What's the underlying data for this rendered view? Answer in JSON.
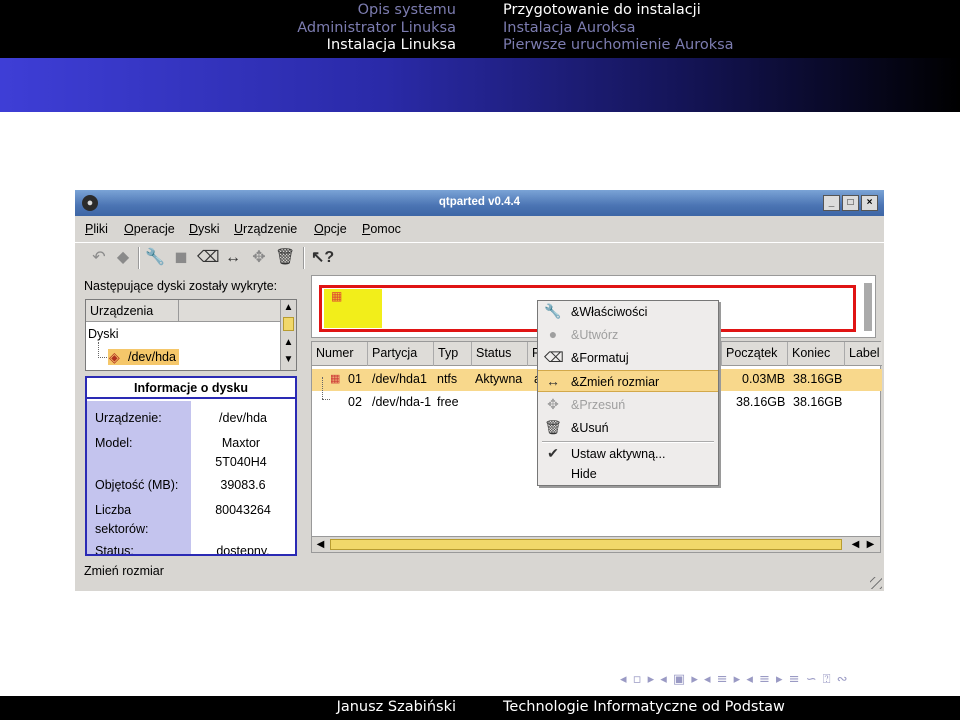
{
  "header": {
    "left_sections": [
      "Opis systemu",
      "Administrator Linuksa",
      "Instalacja Linuksa"
    ],
    "left_current_index": 2,
    "right_subsections": [
      "Przygotowanie do instalacji",
      "Instalacja Auroksa",
      "Pierwsze uruchomienie Auroksa"
    ],
    "right_current_index": 0
  },
  "footer": {
    "author": "Janusz Szabiński",
    "course": "Technologie Informatyczne od Podstaw"
  },
  "beamer_nav": "◂ ▫ ▸ ◂ ▣ ▸ ◂ ≡ ▸ ◂ ≡ ▸ ≡ ∽ ⍰ ∾",
  "window": {
    "title": "qtparted v0.4.4",
    "buttons": {
      "minimize": "_",
      "maximize": "□",
      "close": "×"
    },
    "menu": [
      {
        "accel": "P",
        "rest": "liki"
      },
      {
        "accel": "O",
        "rest": "peracje"
      },
      {
        "accel": "D",
        "rest": "yski"
      },
      {
        "accel": "U",
        "rest": "rządzenie"
      },
      {
        "accel": "O",
        "rest": "pcje"
      },
      {
        "accel": "P",
        "rest": "omoc"
      }
    ],
    "toolbar_icons": [
      "undo-icon",
      "commit-icon",
      "properties-icon",
      "create-icon",
      "format-icon",
      "resize-icon",
      "move-icon",
      "delete-icon",
      "whats-this-icon"
    ],
    "left": {
      "found_label": "Następujące dyski zostały wykryte:",
      "tree_header": "Urządzenia",
      "tree_root": "Dyski",
      "tree_device": "/dev/hda",
      "info": {
        "title": "Informacje o dysku",
        "rows": [
          {
            "k": "Urządzenie:",
            "v": "/dev/hda"
          },
          {
            "k": "Model:",
            "v": "Maxtor 5T040H4"
          },
          {
            "k": "Objętość (MB):",
            "v": "39083.6"
          },
          {
            "k": "Liczba sektorów:",
            "v": "80043264"
          },
          {
            "k": "Status:",
            "v": "dostępny."
          }
        ]
      }
    },
    "table": {
      "columns": [
        "Numer",
        "Partycja",
        "Typ",
        "Status",
        "P",
        "Początek",
        "Koniec",
        "Label"
      ],
      "rows": [
        {
          "num": "01",
          "part": "/dev/hda1",
          "type": "ntfs",
          "status": "Aktywna",
          "p": "a",
          "start": "0.03MB",
          "end": "38.16GB"
        },
        {
          "num": "02",
          "part": "/dev/hda-1",
          "type": "free",
          "status": "",
          "p": "",
          "start": "38.16GB",
          "end": "38.16GB"
        }
      ]
    },
    "context_menu": [
      {
        "label": "&Właściwości",
        "icon": "wrench-icon",
        "enabled": true,
        "highlight": false
      },
      {
        "label": "&Utwórz",
        "icon": "create-icon",
        "enabled": false,
        "highlight": false
      },
      {
        "label": "&Formatuj",
        "icon": "eraser-icon",
        "enabled": true,
        "highlight": false
      },
      {
        "label": "&Zmień rozmiar",
        "icon": "resize-icon",
        "enabled": true,
        "highlight": true
      },
      {
        "label": "&Przesuń",
        "icon": "move-icon",
        "enabled": false,
        "highlight": false
      },
      {
        "label": "&Usuń",
        "icon": "trash-icon",
        "enabled": true,
        "highlight": false
      },
      {
        "label": "Ustaw aktywną...",
        "icon": "check-icon",
        "enabled": true,
        "highlight": false
      },
      {
        "label": "Hide",
        "icon": "",
        "enabled": true,
        "highlight": false
      }
    ],
    "status": "Zmień rozmiar"
  },
  "colors": {
    "selection": "#f8d88c",
    "partition_fill": "#f2ee1a",
    "partition_border": "#e01414",
    "info_border": "#2a2ab4",
    "info_labels_bg": "#c4c4ee"
  }
}
